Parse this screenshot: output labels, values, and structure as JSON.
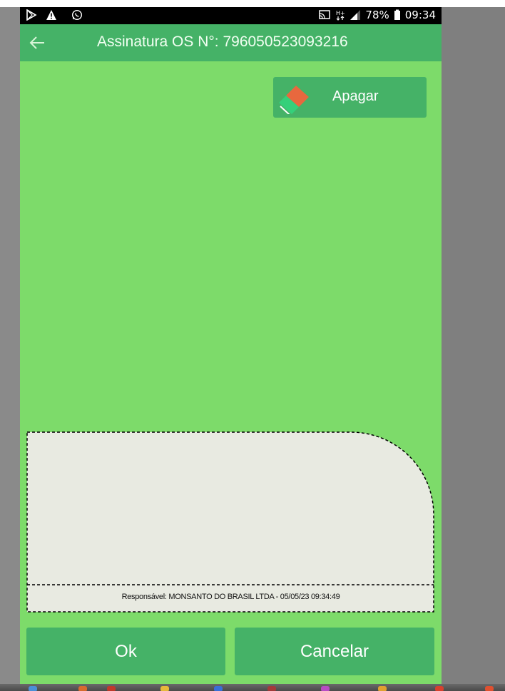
{
  "status_bar": {
    "left_icons": [
      "play-store-icon",
      "warning-icon",
      "whatsapp-icon"
    ],
    "right_icons": [
      "cast-icon",
      "network-h-plus-icon",
      "signal-icon"
    ],
    "battery": "78%",
    "time": "09:34"
  },
  "app_bar": {
    "title": "Assinatura OS N°: 796050523093216",
    "back_icon": "arrow-left-icon"
  },
  "erase_button": {
    "label": "Apagar",
    "icon": "eraser-icon"
  },
  "signature": {
    "responsible": "Responsável: MONSANTO DO BRASIL LTDA - 05/05/23 09:34:49"
  },
  "actions": {
    "ok_label": "Ok",
    "cancel_label": "Cancelar"
  },
  "colors": {
    "background": "#7ddb6a",
    "accent": "#45b267",
    "signature_area": "#e8eae1"
  }
}
